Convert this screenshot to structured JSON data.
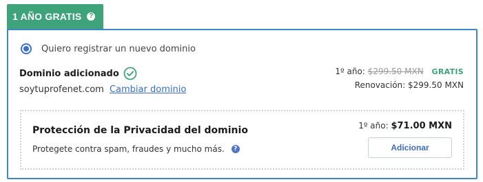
{
  "badge": {
    "label": "1 AÑO GRATIS",
    "help_icon": "question-icon",
    "color": "#3ea37a"
  },
  "registration": {
    "option_label": "Quiero registrar un nuevo dominio",
    "selected": true
  },
  "domain": {
    "status_label": "Dominio adicionado",
    "status_icon": "check-circle-icon",
    "name": "soytuprofenet.com",
    "change_link": "Cambiar dominio"
  },
  "pricing": {
    "first_year_label": "1º año:",
    "original_price": "$299.50 MXN",
    "free_label": "GRATIS",
    "renewal_label": "Renovación: $299.50 MXN"
  },
  "privacy": {
    "title": "Protección de la Privacidad del dominio",
    "description": "Protegete contra spam, fraudes y mucho más.",
    "help_icon": "question-icon",
    "price_label": "1º año:",
    "price": "$71.00 MXN",
    "add_button": "Adicionar"
  },
  "colors": {
    "accent_green": "#3ea37a",
    "border_blue": "#3f86c6",
    "link_blue": "#3a6cc0"
  }
}
